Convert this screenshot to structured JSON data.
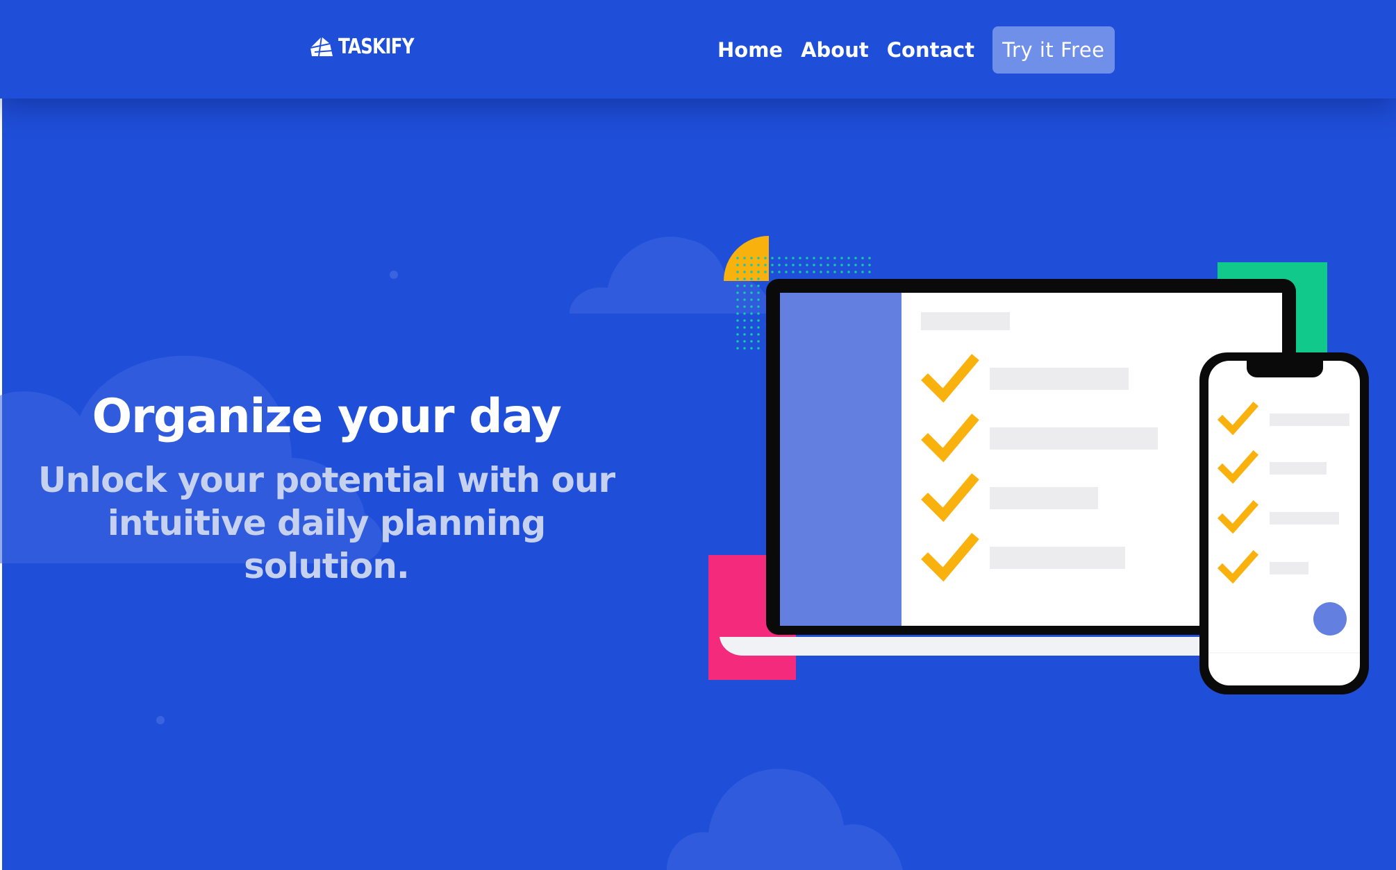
{
  "brand": {
    "name": "TASKIFY",
    "logo_icon": "crystal-icon"
  },
  "nav": {
    "links": [
      "Home",
      "About",
      "Contact"
    ],
    "cta_label": "Try it Free"
  },
  "hero": {
    "title": "Organize your day",
    "subtitle_line1": "Unlock your potential with our",
    "subtitle_line2": "intuitive daily planning solution."
  },
  "illustration": {
    "description_icons": [
      "laptop-icon",
      "phone-icon",
      "checkmark-icon"
    ],
    "checkmark_count_laptop": 4,
    "checkmark_count_phone": 4
  },
  "colors": {
    "background": "#1f4fd8",
    "button": "#6f8fe8",
    "checkmark": "#f9b10e",
    "accent_green": "#10c98b",
    "accent_pink": "#f42a7c",
    "accent_yellow": "#f9b10e",
    "sidebar": "#6380e0",
    "subtitle": "#c6d1ef"
  }
}
